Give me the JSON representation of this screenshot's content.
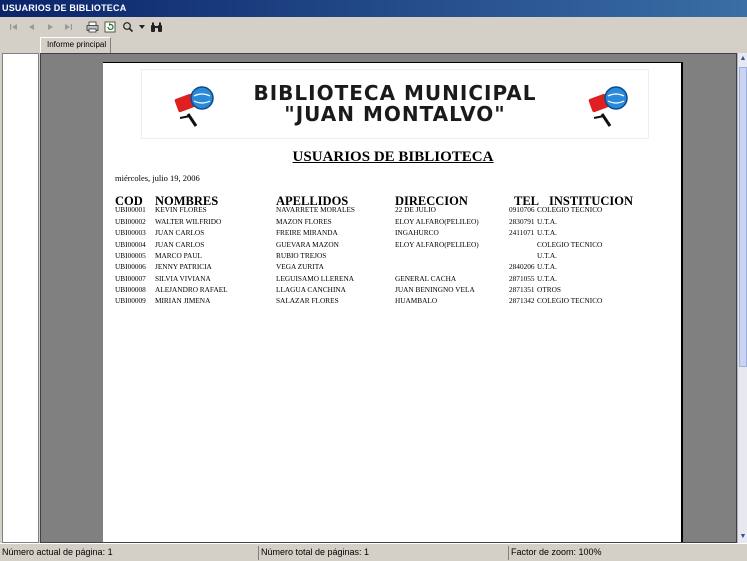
{
  "window": {
    "title": "USUARIOS DE BIBLIOTECA"
  },
  "toolbar": {
    "buttons": [
      {
        "name": "first-page-icon",
        "glyph": "⏮"
      },
      {
        "name": "prev-page-icon",
        "glyph": "◀"
      },
      {
        "name": "next-page-icon",
        "glyph": "▶"
      },
      {
        "name": "last-page-icon",
        "glyph": "⏭"
      },
      {
        "name": "print-icon",
        "glyph": "🖶"
      },
      {
        "name": "refresh-icon",
        "glyph": "⟳"
      },
      {
        "name": "zoom-icon",
        "glyph": "🔍"
      },
      {
        "name": "dropdown-icon",
        "glyph": "▾"
      },
      {
        "name": "find-icon",
        "glyph": "👁"
      }
    ]
  },
  "tabs": {
    "main": "Informe principal"
  },
  "report": {
    "banner_line1": "BIBLIOTECA MUNICIPAL",
    "banner_line2": "\"JUAN MONTALVO\"",
    "title": "USUARIOS DE BIBLIOTECA",
    "date": "miércoles, julio 19, 2006",
    "headers": {
      "cod": "COD",
      "nombres": "NOMBRES",
      "apellidos": "APELLIDOS",
      "direccion": "DIRECCION",
      "tel": "TEL",
      "institucion": "INSTITUCION"
    },
    "rows": [
      {
        "cod": "UBI00001",
        "nombres": "KEVIN FLORES",
        "apellidos": "NAVARRETE MORALES",
        "direccion": "22 DE JULIO",
        "tel": "0910706",
        "institucion": "COLEGIO TECNICO"
      },
      {
        "cod": "UBI00002",
        "nombres": "WALTER WILFRIDO",
        "apellidos": "MAZON FLORES",
        "direccion": "ELOY ALFARO(PELILEO)",
        "tel": "2830791",
        "institucion": "U.T.A."
      },
      {
        "cod": "UBI00003",
        "nombres": "JUAN CARLOS",
        "apellidos": "FREIRE MIRANDA",
        "direccion": "INGAHURCO",
        "tel": "2411071",
        "institucion": "U.T.A."
      },
      {
        "cod": "UBI00004",
        "nombres": "JUAN CARLOS",
        "apellidos": "GUEVARA MAZON",
        "direccion": "ELOY ALFARO(PELILEO)",
        "tel": "",
        "institucion": "COLEGIO TECNICO"
      },
      {
        "cod": "UBI00005",
        "nombres": "MARCO PAUL",
        "apellidos": "RUBIO TREJOS",
        "direccion": "",
        "tel": "",
        "institucion": "U.T.A."
      },
      {
        "cod": "UBI00006",
        "nombres": "JENNY PATRICIA",
        "apellidos": "VEGA ZURITA",
        "direccion": "",
        "tel": "2840206",
        "institucion": "U.T.A."
      },
      {
        "cod": "UBI00007",
        "nombres": "SILVIA VIVIANA",
        "apellidos": "LEGUISAMO LLERENA",
        "direccion": "GENERAL CACHA",
        "tel": "2871055",
        "institucion": "U.T.A."
      },
      {
        "cod": "UBI00008",
        "nombres": "ALEJANDRO RAFAEL",
        "apellidos": "LLAGUA CANCHINA",
        "direccion": "JUAN BENINGNO VELA",
        "tel": "2871351",
        "institucion": "OTROS"
      },
      {
        "cod": "UBI00009",
        "nombres": "MIRIAN JIMENA",
        "apellidos": "SALAZAR FLORES",
        "direccion": "HUAMBALO",
        "tel": "2871342",
        "institucion": "COLEGIO TECNICO"
      }
    ]
  },
  "status": {
    "current_page": "Número actual de página: 1",
    "total_pages": "Número total de páginas: 1",
    "zoom": "Factor de zoom: 100%"
  },
  "colors": {
    "titlebar_start": "#0a246a",
    "titlebar_end": "#3a6ea5",
    "viewer_bg": "#808080",
    "chrome": "#d4d0c8"
  }
}
